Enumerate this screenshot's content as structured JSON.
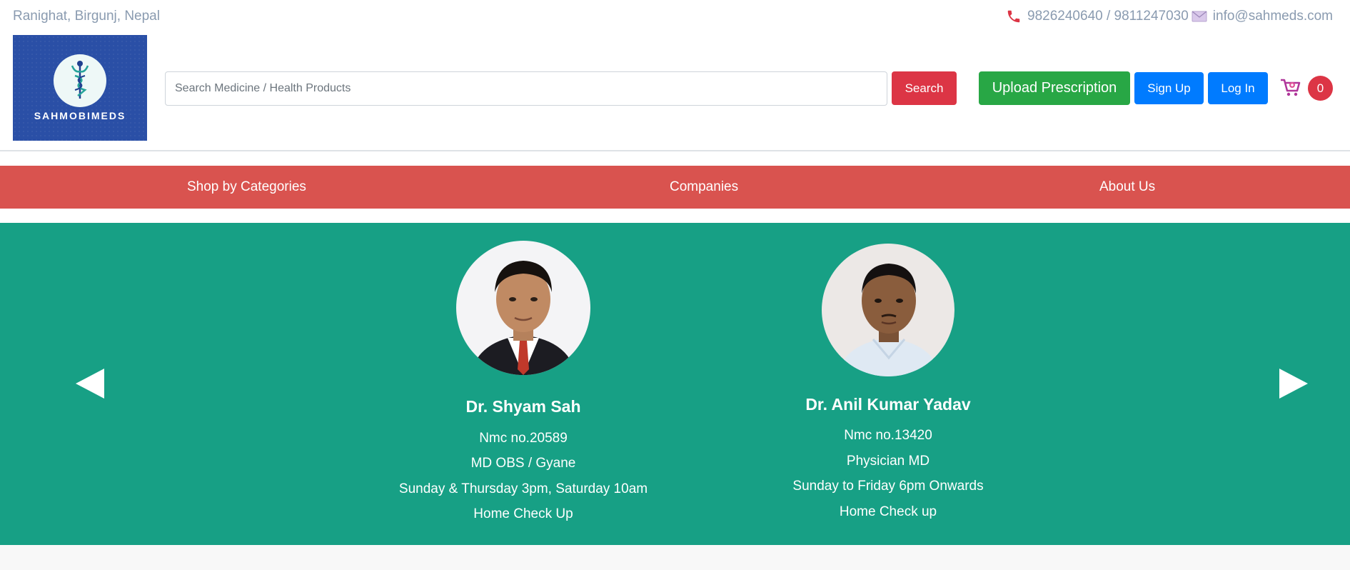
{
  "topbar": {
    "location": "Ranighat, Birgunj, Nepal",
    "phone": "9826240640 / 9811247030",
    "email": "info@sahmeds.com"
  },
  "logo": {
    "brand": "SAHMOBIMEDS"
  },
  "search": {
    "placeholder": "Search Medicine / Health Products",
    "button_label": "Search"
  },
  "actions": {
    "upload_label": "Upload Prescription",
    "signup_label": "Sign Up",
    "login_label": "Log In",
    "cart_count": "0"
  },
  "nav": {
    "items": [
      {
        "label": "Shop by Categories"
      },
      {
        "label": "Companies"
      },
      {
        "label": "About Us"
      }
    ]
  },
  "doctors": [
    {
      "name": "Dr. Shyam Sah",
      "nmc": "Nmc no.20589",
      "specialty": "MD OBS / Gyane",
      "schedule": "Sunday & Thursday 3pm, Saturday 10am",
      "service": "Home Check Up"
    },
    {
      "name": "Dr. Anil Kumar Yadav",
      "nmc": "Nmc no.13420",
      "specialty": "Physician MD",
      "schedule": "Sunday to Friday 6pm Onwards",
      "service": "Home Check up"
    }
  ],
  "icons": {
    "phone": "phone-icon",
    "mail": "mail-icon",
    "cart": "cart-icon",
    "prev": "chevron-left-icon",
    "next": "chevron-right-icon"
  },
  "colors": {
    "primary": "#007bff",
    "danger": "#dc3545",
    "success": "#28a745",
    "nav": "#d9534f",
    "teal": "#17a085",
    "logo_bg": "#2a4fa6"
  }
}
